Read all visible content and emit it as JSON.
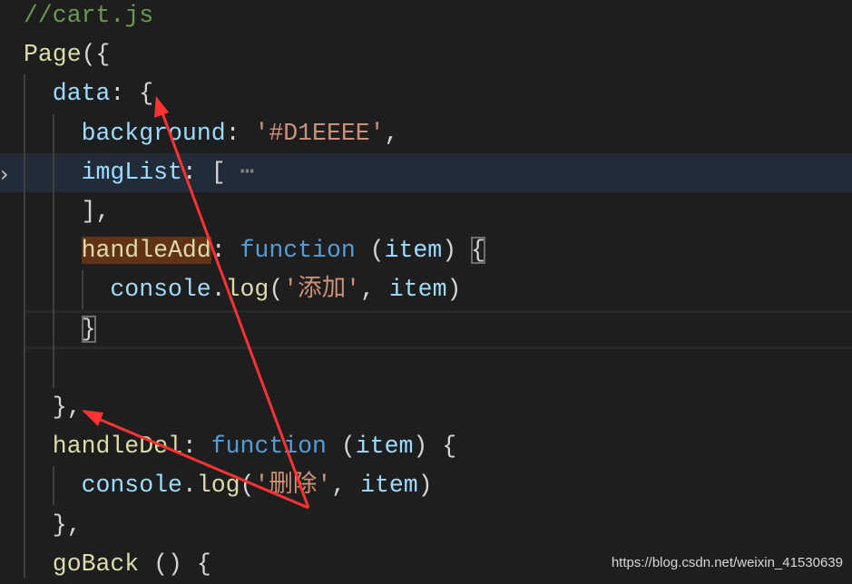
{
  "editor": {
    "lines": [
      {
        "indent": 0,
        "tokens": [
          {
            "t": "comment",
            "v": "//cart.js"
          }
        ]
      },
      {
        "indent": 0,
        "tokens": [
          {
            "t": "func",
            "v": "Page"
          },
          {
            "t": "punc",
            "v": "({"
          }
        ]
      },
      {
        "indent": 1,
        "tokens": [
          {
            "t": "prop",
            "v": "data"
          },
          {
            "t": "punc",
            "v": ": {"
          }
        ]
      },
      {
        "indent": 2,
        "tokens": [
          {
            "t": "prop",
            "v": "background"
          },
          {
            "t": "punc",
            "v": ": "
          },
          {
            "t": "str",
            "v": "'#D1EEEE'"
          },
          {
            "t": "punc",
            "v": ","
          }
        ]
      },
      {
        "indent": 2,
        "current": true,
        "tokens": [
          {
            "t": "prop",
            "v": "imgList"
          },
          {
            "t": "punc",
            "v": ": [ "
          },
          {
            "t": "fold",
            "v": "⋯"
          }
        ]
      },
      {
        "indent": 2,
        "tokens": [
          {
            "t": "punc",
            "v": "],"
          }
        ]
      },
      {
        "indent": 2,
        "tokens": [
          {
            "t": "func hl",
            "v": "handleAdd"
          },
          {
            "t": "punc",
            "v": ": "
          },
          {
            "t": "kw",
            "v": "function"
          },
          {
            "t": "punc",
            "v": " ("
          },
          {
            "t": "prop",
            "v": "item"
          },
          {
            "t": "punc",
            "v": ") "
          },
          {
            "t": "punc bracket",
            "v": "{"
          }
        ]
      },
      {
        "indent": 3,
        "tokens": [
          {
            "t": "prop",
            "v": "console"
          },
          {
            "t": "punc",
            "v": "."
          },
          {
            "t": "func",
            "v": "log"
          },
          {
            "t": "punc",
            "v": "("
          },
          {
            "t": "str",
            "v": "'添加'"
          },
          {
            "t": "punc",
            "v": ", "
          },
          {
            "t": "prop",
            "v": "item"
          },
          {
            "t": "punc",
            "v": ")"
          }
        ]
      },
      {
        "indent": 2,
        "bordered": true,
        "tokens": [
          {
            "t": "punc bracket",
            "v": "}"
          }
        ]
      },
      {
        "indent": 0,
        "tokens": []
      },
      {
        "indent": 1,
        "tokens": [
          {
            "t": "punc",
            "v": "},"
          }
        ]
      },
      {
        "indent": 1,
        "tokens": [
          {
            "t": "func",
            "v": "handleDel"
          },
          {
            "t": "punc",
            "v": ": "
          },
          {
            "t": "kw",
            "v": "function"
          },
          {
            "t": "punc",
            "v": " ("
          },
          {
            "t": "prop",
            "v": "item"
          },
          {
            "t": "punc",
            "v": ") {"
          }
        ]
      },
      {
        "indent": 2,
        "tokens": [
          {
            "t": "prop",
            "v": "console"
          },
          {
            "t": "punc",
            "v": "."
          },
          {
            "t": "func",
            "v": "log"
          },
          {
            "t": "punc",
            "v": "("
          },
          {
            "t": "str",
            "v": "'删除'"
          },
          {
            "t": "punc",
            "v": ", "
          },
          {
            "t": "prop",
            "v": "item"
          },
          {
            "t": "punc",
            "v": ")"
          }
        ]
      },
      {
        "indent": 1,
        "tokens": [
          {
            "t": "punc",
            "v": "},"
          }
        ]
      },
      {
        "indent": 1,
        "tokens": [
          {
            "t": "func",
            "v": "goBack"
          },
          {
            "t": "punc",
            "v": " () {"
          }
        ]
      }
    ]
  },
  "annotation_color": "#ff3333",
  "fold_icon": "chevron-right-icon",
  "watermark": "https://blog.csdn.net/weixin_41530639"
}
